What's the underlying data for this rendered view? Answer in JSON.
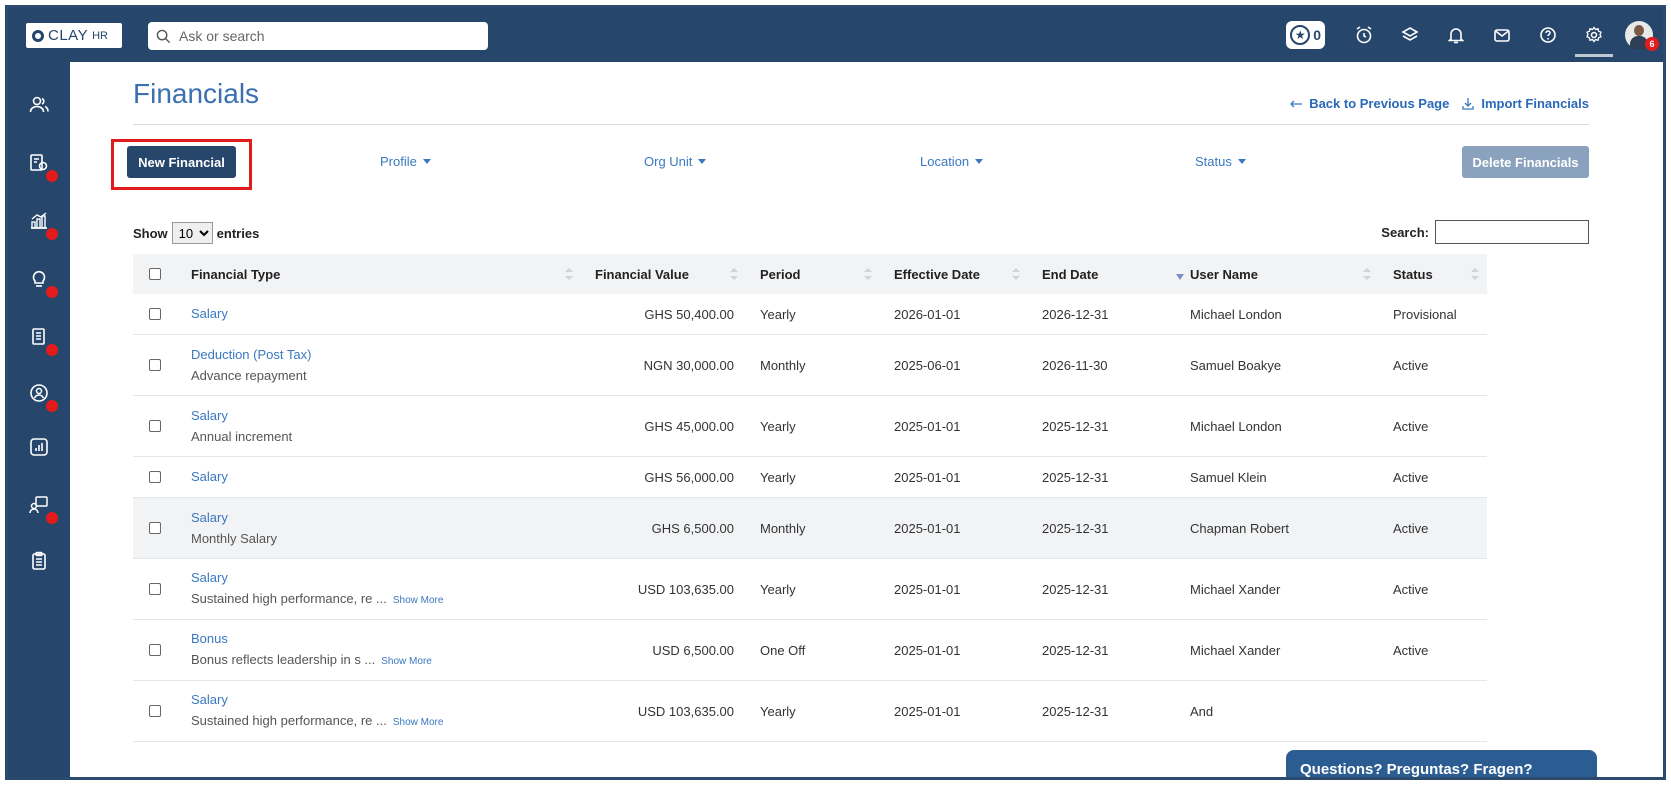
{
  "topbar": {
    "logo_text": "CLAY",
    "logo_sub": "HR",
    "search_placeholder": "Ask or search",
    "star_count": "0",
    "notification_count": "6"
  },
  "page": {
    "title": "Financials",
    "back_link": "Back to Previous Page",
    "import_link": "Import Financials"
  },
  "toolbar": {
    "new_button": "New Financial",
    "delete_button": "Delete Financials",
    "filters": [
      "Profile",
      "Org Unit",
      "Location",
      "Status"
    ]
  },
  "table_controls": {
    "show_label": "Show",
    "entries_value": "10",
    "entries_label": "entries",
    "search_label": "Search:"
  },
  "table": {
    "headers": [
      "Financial Type",
      "Financial Value",
      "Period",
      "Effective Date",
      "End Date",
      "User Name",
      "Status"
    ],
    "rows": [
      {
        "type": "Salary",
        "desc": "",
        "more": "",
        "value": "GHS 50,400.00",
        "period": "Yearly",
        "effective": "2026-01-01",
        "end": "2026-12-31",
        "user": "Michael London",
        "status": "Provisional"
      },
      {
        "type": "Deduction (Post Tax)",
        "desc": "Advance repayment",
        "more": "",
        "value": "NGN 30,000.00",
        "period": "Monthly",
        "effective": "2025-06-01",
        "end": "2026-11-30",
        "user": "Samuel Boakye",
        "status": "Active"
      },
      {
        "type": "Salary",
        "desc": "Annual increment",
        "more": "",
        "value": "GHS 45,000.00",
        "period": "Yearly",
        "effective": "2025-01-01",
        "end": "2025-12-31",
        "user": "Michael London",
        "status": "Active"
      },
      {
        "type": "Salary",
        "desc": "",
        "more": "",
        "value": "GHS 56,000.00",
        "period": "Yearly",
        "effective": "2025-01-01",
        "end": "2025-12-31",
        "user": "Samuel Klein",
        "status": "Active"
      },
      {
        "type": "Salary",
        "desc": "Monthly Salary",
        "more": "",
        "value": "GHS 6,500.00",
        "period": "Monthly",
        "effective": "2025-01-01",
        "end": "2025-12-31",
        "user": "Chapman Robert",
        "status": "Active"
      },
      {
        "type": "Salary",
        "desc": "Sustained high performance, re ...",
        "more": "Show More",
        "value": "USD 103,635.00",
        "period": "Yearly",
        "effective": "2025-01-01",
        "end": "2025-12-31",
        "user": "Michael Xander",
        "status": "Active"
      },
      {
        "type": "Bonus",
        "desc": "Bonus reflects leadership in s ...",
        "more": "Show More",
        "value": "USD 6,500.00",
        "period": "One Off",
        "effective": "2025-01-01",
        "end": "2025-12-31",
        "user": "Michael Xander",
        "status": "Active"
      },
      {
        "type": "Salary",
        "desc": "Sustained high performance, re ...",
        "more": "Show More",
        "value": "USD 103,635.00",
        "period": "Yearly",
        "effective": "2025-01-01",
        "end": "2025-12-31",
        "user": "And",
        "status": ""
      }
    ]
  },
  "chat": {
    "label": "Questions? Preguntas? Fragen?"
  },
  "colors": {
    "brand": "#26466b",
    "link": "#3a78c2",
    "alert": "#e41b1b"
  }
}
